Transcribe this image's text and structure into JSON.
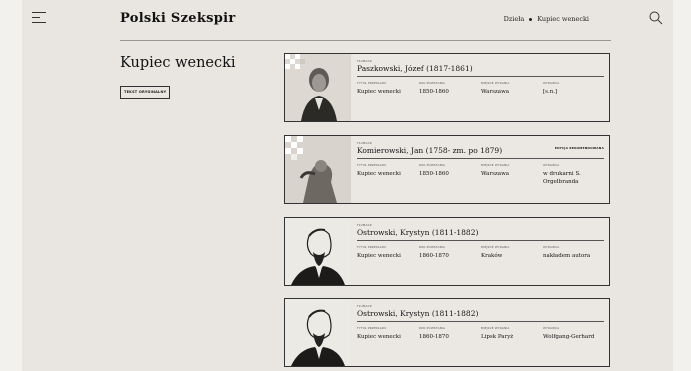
{
  "header": {
    "logo": "Polski Szekspir",
    "breadcrumb": [
      "Dzieła",
      "Kupiec wenecki"
    ]
  },
  "main": {
    "title": "Kupiec wenecki",
    "original_text_button": "TEKST ORYGINALNY"
  },
  "labels": {
    "translator": "TŁUMACZ",
    "original_title": "TYTUŁ PRZEKŁADU",
    "year": "ROK POWSTANIA",
    "place": "MIEJSCE WYDANIA",
    "publisher": "WYDAWCA",
    "recommended": "EDYCJA REKOMENDOWANA"
  },
  "cards": [
    {
      "translator": "Paszkowski, Józef (1817-1861)",
      "title": "Kupiec wenecki",
      "year": "1850-1860",
      "place": "Warszawa",
      "publisher": "[s.n.]",
      "recommended": false
    },
    {
      "translator": "Komierowski, Jan (1758- zm. po 1879)",
      "title": "Kupiec wenecki",
      "year": "1850-1860",
      "place": "Warszawa",
      "publisher": "w drukarni S. Orgelbranda",
      "recommended": true
    },
    {
      "translator": "Ostrowski, Krystyn (1811-1882)",
      "title": "Kupiec wenecki",
      "year": "1860-1870",
      "place": "Kraków",
      "publisher": "nakładem autora",
      "recommended": false
    },
    {
      "translator": "Ostrowski, Krystyn (1811-1882)",
      "title": "Kupiec wenecki",
      "year": "1860-1870",
      "place": "Lipsk Paryż",
      "publisher": "Wolfgang-Gerhard",
      "recommended": false
    }
  ]
}
